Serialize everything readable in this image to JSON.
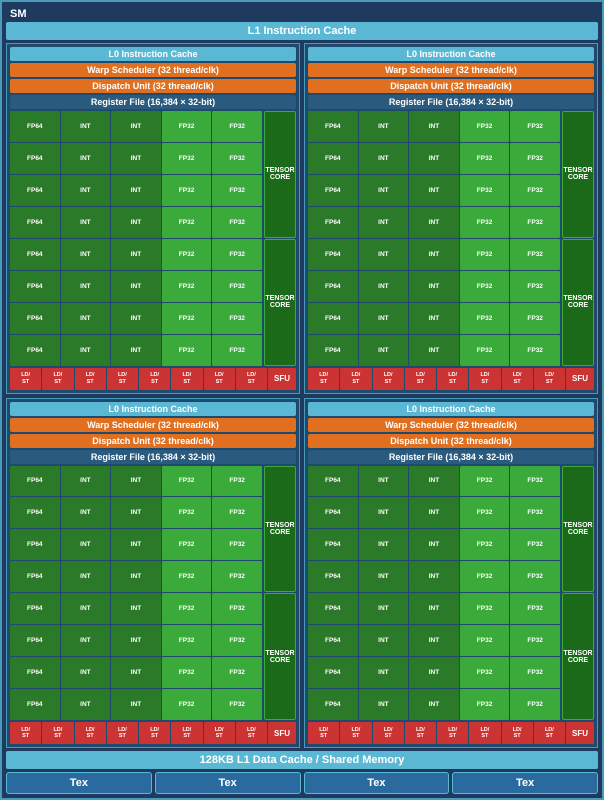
{
  "sm": {
    "title": "SM",
    "l1_instruction_cache": "L1 Instruction Cache",
    "l1_data_cache": "128KB L1 Data Cache / Shared Memory",
    "quadrant": {
      "l0_cache": "L0 Instruction Cache",
      "warp_scheduler": "Warp Scheduler (32 thread/clk)",
      "dispatch_unit": "Dispatch Unit (32 thread/clk)",
      "register_file": "Register File (16,384 × 32-bit)"
    },
    "tex_cells": [
      "Tex",
      "Tex",
      "Tex",
      "Tex"
    ],
    "cores": {
      "rows": [
        [
          "FP64",
          "INT",
          "INT",
          "FP32",
          "FP32"
        ],
        [
          "FP64",
          "INT",
          "INT",
          "FP32",
          "FP32"
        ],
        [
          "FP64",
          "INT",
          "INT",
          "FP32",
          "FP32"
        ],
        [
          "FP64",
          "INT",
          "INT",
          "FP32",
          "FP32"
        ],
        [
          "FP64",
          "INT",
          "INT",
          "FP32",
          "FP32"
        ],
        [
          "FP64",
          "INT",
          "INT",
          "FP32",
          "FP32"
        ],
        [
          "FP64",
          "INT",
          "INT",
          "FP32",
          "FP32"
        ],
        [
          "FP64",
          "INT",
          "INT",
          "FP32",
          "FP32"
        ]
      ],
      "tensor_cores": [
        "TENSOR CORE",
        "TENSOR CORE"
      ],
      "ldst_count": 8,
      "sfu": "SFU"
    }
  }
}
